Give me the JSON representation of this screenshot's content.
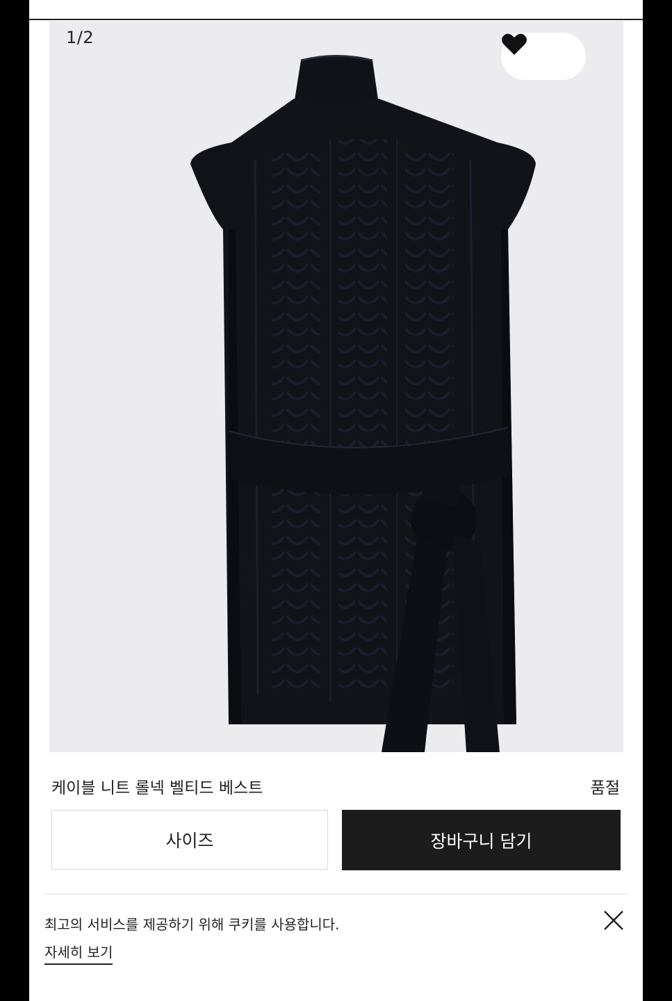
{
  "gallery": {
    "counter": "1/2",
    "wishlist_icon": "heart-icon",
    "image_subject": "knit-vest-photo"
  },
  "product": {
    "name": "케이블 니트 롤넥 벨티드 베스트",
    "status": "품절"
  },
  "actions": {
    "size_label": "사이즈",
    "cart_label": "장바구니 담기"
  },
  "cookie_banner": {
    "message": "최고의 서비스를 제공하기 위해 쿠키를 사용합니다.",
    "link_label": "자세히 보기",
    "close_icon": "close-icon"
  },
  "colors": {
    "cart_button_bg": "#1c1c1c",
    "gallery_bg": "#ececee",
    "garment": "#111318"
  }
}
